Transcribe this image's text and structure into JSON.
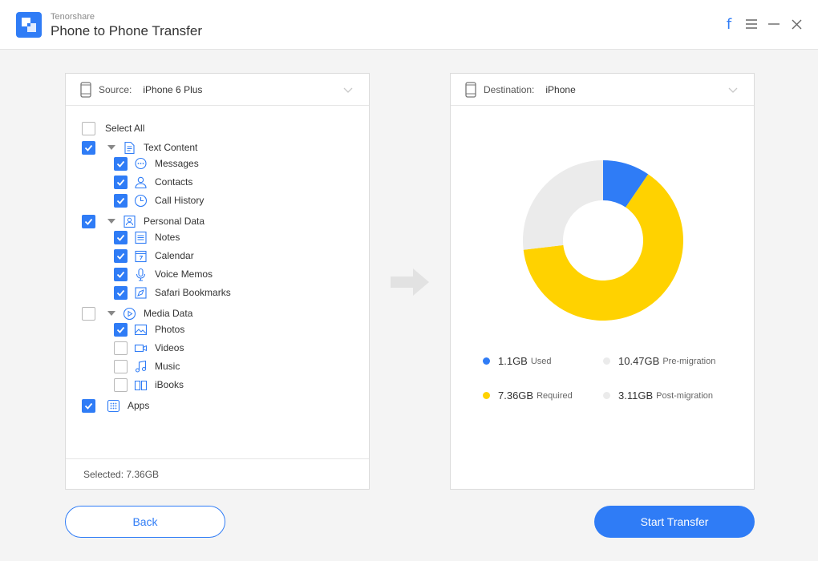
{
  "window": {
    "brand": "Tenorshare",
    "title": "Phone to Phone Transfer",
    "controls": [
      "facebook-icon",
      "menu-icon",
      "minimize-icon",
      "close-icon"
    ]
  },
  "source": {
    "label": "Source:",
    "device": "iPhone 6 Plus",
    "select_all": {
      "label": "Select All",
      "checked": false
    },
    "groups": [
      {
        "label": "Text Content",
        "icon": "document-icon",
        "checked": true,
        "items": [
          {
            "label": "Messages",
            "icon": "message-icon",
            "checked": true
          },
          {
            "label": "Contacts",
            "icon": "contact-icon",
            "checked": true
          },
          {
            "label": "Call History",
            "icon": "clock-icon",
            "checked": true
          }
        ]
      },
      {
        "label": "Personal Data",
        "icon": "person-card-icon",
        "checked": true,
        "items": [
          {
            "label": "Notes",
            "icon": "notes-icon",
            "checked": true
          },
          {
            "label": "Calendar",
            "icon": "calendar-icon",
            "checked": true
          },
          {
            "label": "Voice Memos",
            "icon": "microphone-icon",
            "checked": true
          },
          {
            "label": "Safari Bookmarks",
            "icon": "compass-icon",
            "checked": true
          }
        ]
      },
      {
        "label": "Media Data",
        "icon": "play-icon",
        "checked": false,
        "items": [
          {
            "label": "Photos",
            "icon": "image-icon",
            "checked": true
          },
          {
            "label": "Videos",
            "icon": "video-icon",
            "checked": false
          },
          {
            "label": "Music",
            "icon": "music-icon",
            "checked": false
          },
          {
            "label": "iBooks",
            "icon": "book-icon",
            "checked": false
          }
        ]
      }
    ],
    "apps": {
      "label": "Apps",
      "icon": "apps-grid-icon",
      "checked": true
    },
    "selected_label": "Selected: 7.36GB"
  },
  "destination": {
    "label": "Destination:",
    "device": "iPhone",
    "usage": [
      {
        "value": "1.1GB",
        "label": "Used",
        "gb": 1.1,
        "color": "#2f7cf6"
      },
      {
        "value": "10.47GB",
        "label": "Pre-migration",
        "gb": 10.47,
        "color": "#ebebeb"
      },
      {
        "value": "7.36GB",
        "label": "Required",
        "gb": 7.36,
        "color": "#ffd200"
      },
      {
        "value": "3.11GB",
        "label": "Post-migration",
        "gb": 3.11,
        "color": "#ebebeb"
      }
    ]
  },
  "buttons": {
    "back": "Back",
    "start": "Start Transfer"
  },
  "colors": {
    "accent": "#2f7cf6",
    "required": "#ffd200",
    "free": "#ebebeb"
  }
}
